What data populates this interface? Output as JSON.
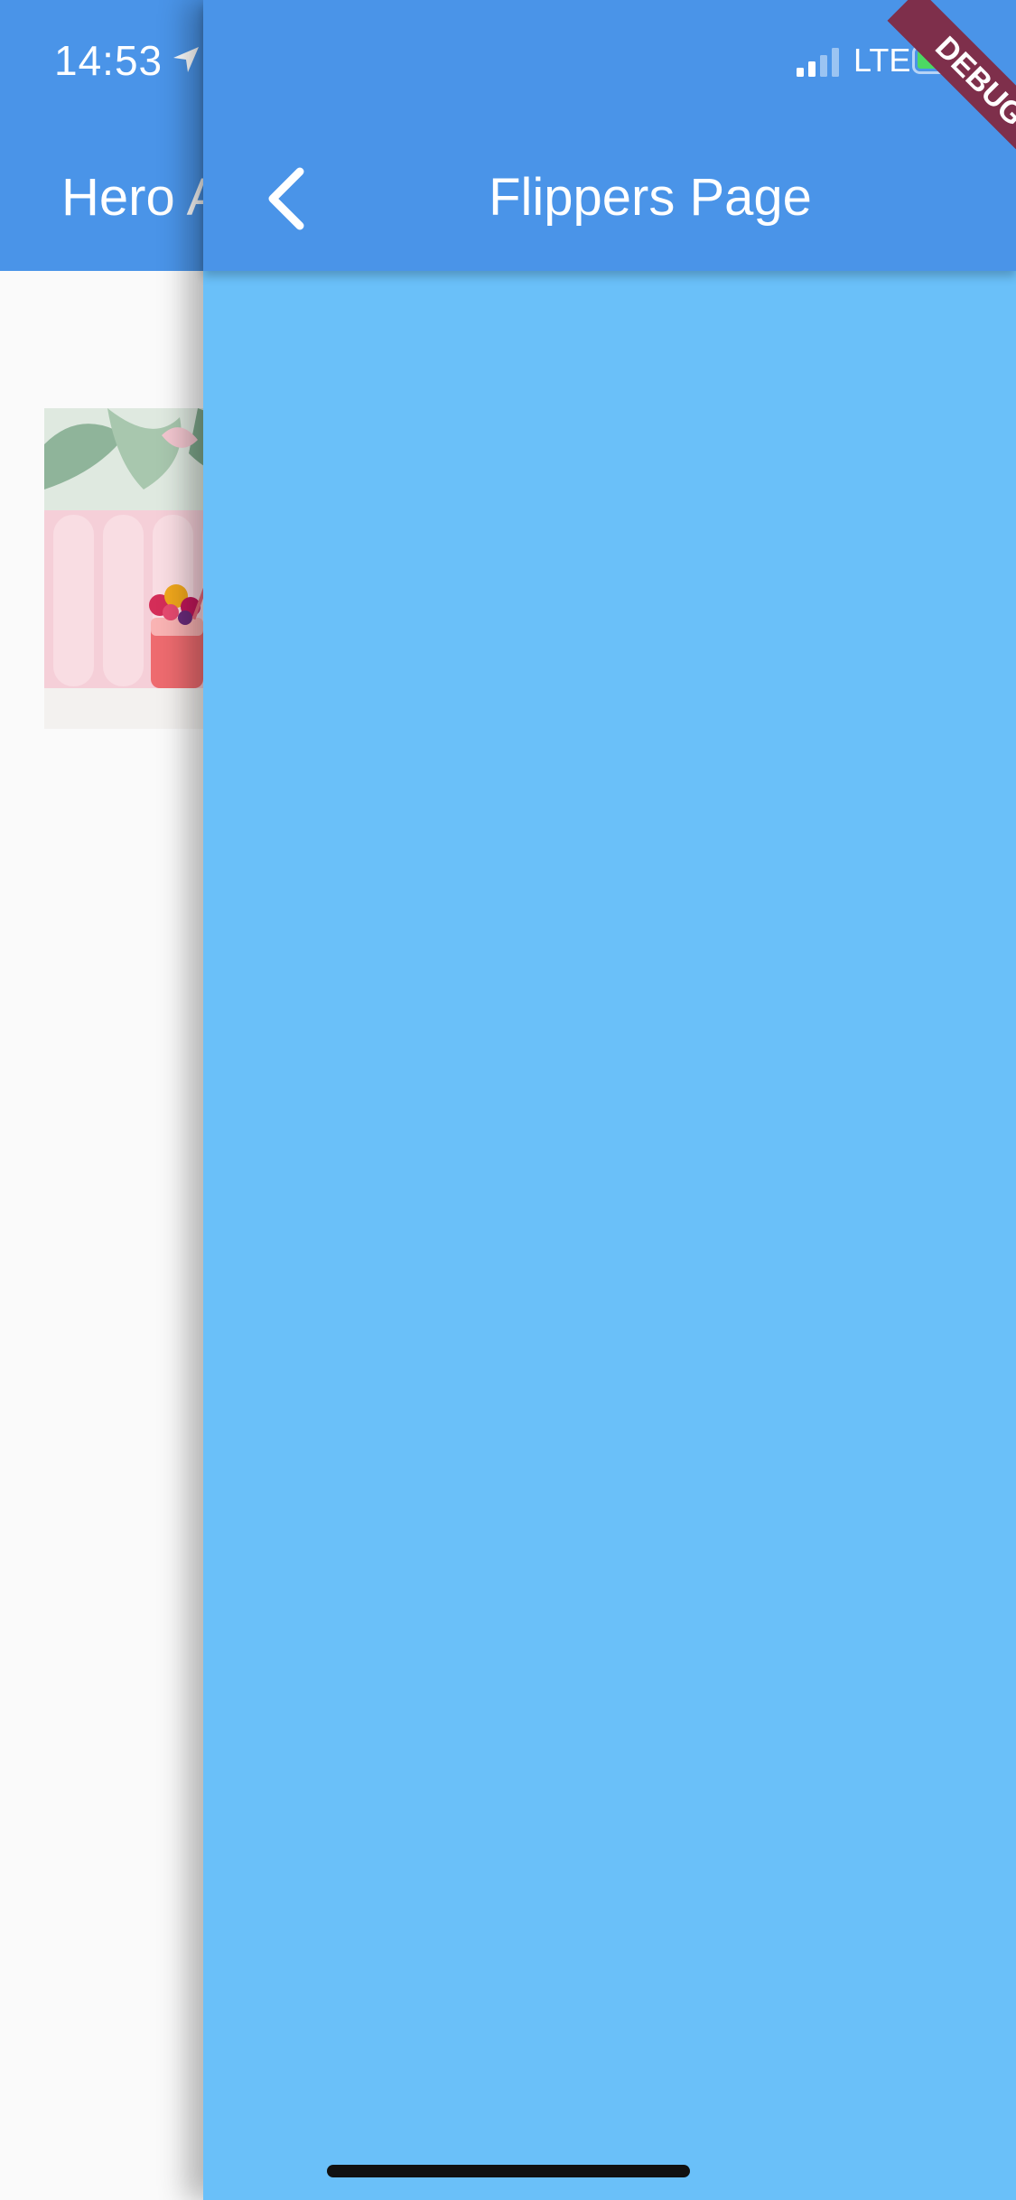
{
  "status_bar": {
    "time": "14:53",
    "network": "LTE"
  },
  "back_page": {
    "title": "Hero A",
    "image": "drink-photo"
  },
  "front_page": {
    "title": "Flippers Page",
    "background": "#6ac0f9",
    "appbar_color": "#4a94e8"
  },
  "debug_banner": {
    "label": "DEBUG"
  },
  "colors": {
    "primary": "#4a94e8",
    "page_bg": "#6ac0f9",
    "banner": "#7e2f4b",
    "battery": "#4cd964"
  }
}
